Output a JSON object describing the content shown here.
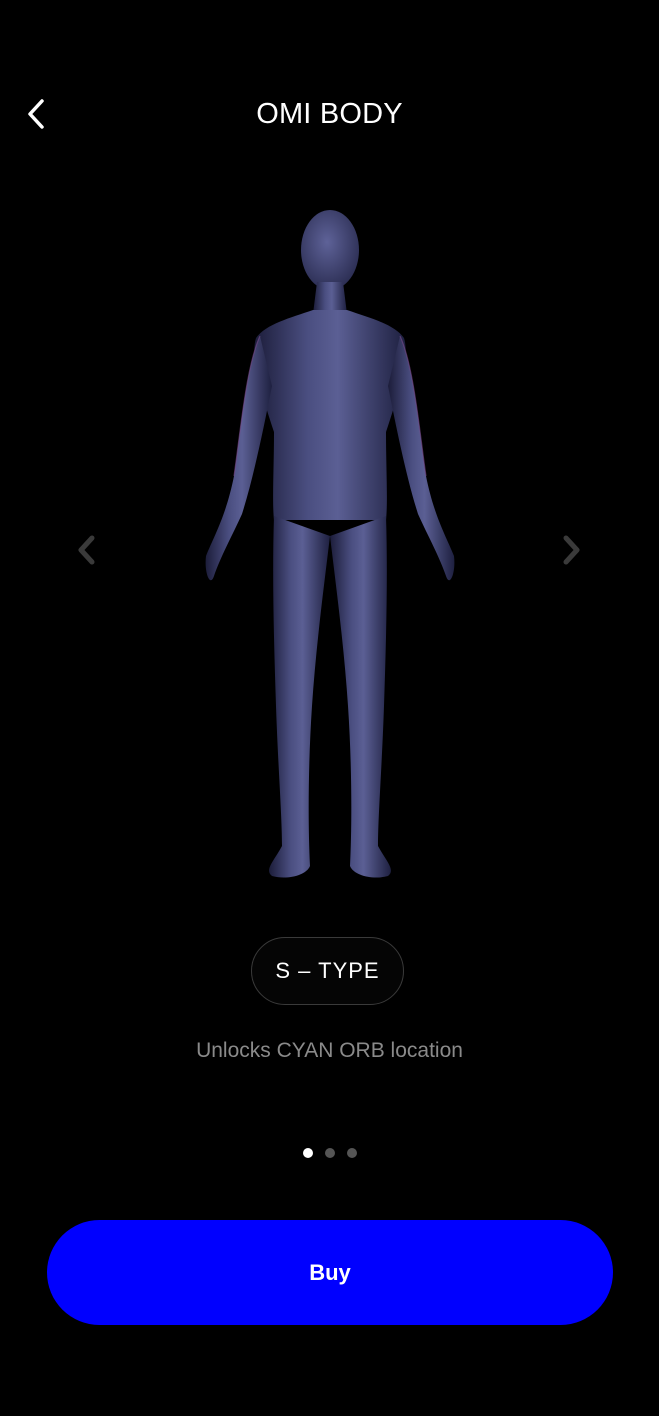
{
  "header": {
    "title": "OMI BODY",
    "back_icon": "chevron-left-icon"
  },
  "carousel": {
    "prev_icon": "chevron-left-icon",
    "next_icon": "chevron-right-icon",
    "figure_color": "#3a3d66",
    "active_index": 1,
    "total": 3
  },
  "badge": {
    "label": "S – TYPE"
  },
  "description": "Unlocks CYAN ORB location",
  "buy_button": {
    "label": "Buy",
    "color": "#0000ff"
  }
}
